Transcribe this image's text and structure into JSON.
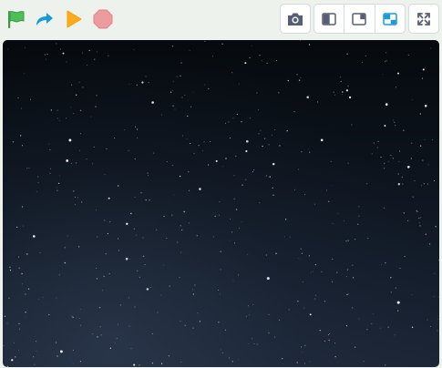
{
  "controls": {
    "green_flag": {
      "icon": "green-flag-icon",
      "color": "#4cbf56"
    },
    "redo": {
      "icon": "redo-arrow-icon",
      "color": "#1a9bd7"
    },
    "play": {
      "icon": "play-icon",
      "color": "#ffab19"
    },
    "stop": {
      "icon": "stop-icon",
      "color": "#ec9c9c"
    }
  },
  "toolbar_buttons": {
    "screenshot": {
      "icon": "camera-icon"
    },
    "layout_small": {
      "icon": "small-stage-layout-icon"
    },
    "layout_large": {
      "icon": "large-stage-layout-icon"
    },
    "layout_window": {
      "icon": "window-layout-icon",
      "active_color": "#1a9bd7"
    },
    "fullscreen": {
      "icon": "fullscreen-icon"
    }
  },
  "stage": {
    "backdrop": "night-sky-stars",
    "colors": {
      "top": "#060a0e",
      "bottom": "#1c2637"
    }
  }
}
